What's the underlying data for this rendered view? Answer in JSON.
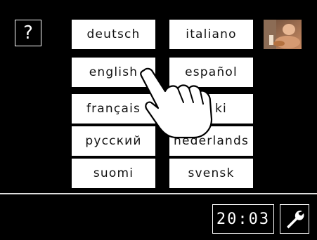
{
  "help": {
    "label": "?"
  },
  "languages": [
    {
      "label": "deutsch"
    },
    {
      "label": "italiano"
    },
    {
      "label": "english"
    },
    {
      "label": "español"
    },
    {
      "label": "français"
    },
    {
      "label": "ki"
    },
    {
      "label": "русский"
    },
    {
      "label": "nederlands"
    },
    {
      "label": "suomi"
    },
    {
      "label": "svensk"
    }
  ],
  "status_bar": {
    "clock": "20:03"
  },
  "icons": {
    "thumbnail": "cooking-photo-thumbnail",
    "settings": "wrench-icon",
    "hand": "pointing-hand-icon"
  }
}
